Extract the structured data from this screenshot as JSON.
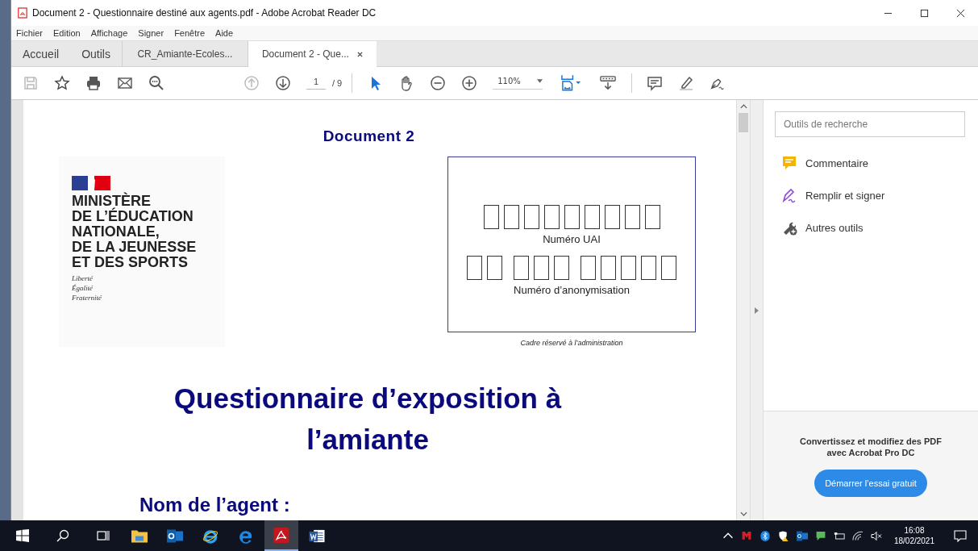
{
  "window": {
    "title": "Document 2 - Questionnaire destiné aux agents.pdf - Adobe Acrobat Reader DC"
  },
  "menu": [
    "Fichier",
    "Edition",
    "Affichage",
    "Signer",
    "Fenêtre",
    "Aide"
  ],
  "tabs": [
    {
      "label": "Accueil",
      "kind": "home",
      "selected": false
    },
    {
      "label": "Outils",
      "kind": "home",
      "selected": false
    },
    {
      "label": "CR_Amiante-Ecoles...",
      "kind": "doc",
      "selected": false
    },
    {
      "label": "Document 2 - Que...",
      "kind": "doc",
      "selected": true
    }
  ],
  "toolbar": {
    "page": "1",
    "page_count": "/ 9",
    "zoom": "110%"
  },
  "document": {
    "heading": "Document 2",
    "logo_lines": [
      "MINISTÈRE",
      "DE L’ÉDUCATION",
      "NATIONALE,",
      "DE LA JEUNESSE",
      "ET DES SPORTS"
    ],
    "motto": [
      "Liberté",
      "Égalité",
      "Fraternité"
    ],
    "uai_label": "Numéro UAI",
    "anon_label": "Numéro d’anonymisation",
    "admin_caption": "Cadre réservé à l’administration",
    "title": "Questionnaire d’exposition à l’amiante",
    "field_label": "Nom de l’agent :"
  },
  "right_pane": {
    "search": {
      "placeholder": "Outils de recherche"
    },
    "tools": [
      {
        "label": "Commentaire",
        "kind": "comment"
      },
      {
        "label": "Remplir et signer",
        "kind": "sign"
      },
      {
        "label": "Autres outils",
        "kind": "more"
      }
    ],
    "promo": "Convertissez et modifiez des PDF avec Acrobat Pro DC",
    "promo_button": "Démarrer l’essai gratuit"
  },
  "taskbar": {
    "apps": [
      {
        "kind": "folder",
        "selected": false
      },
      {
        "kind": "outlook",
        "selected": false
      },
      {
        "kind": "ie",
        "selected": false
      },
      {
        "kind": "edge",
        "selected": false
      },
      {
        "kind": "acrobat",
        "selected": true
      },
      {
        "kind": "word",
        "selected": false
      }
    ],
    "time": "16:08",
    "date": "18/02/2021"
  }
}
